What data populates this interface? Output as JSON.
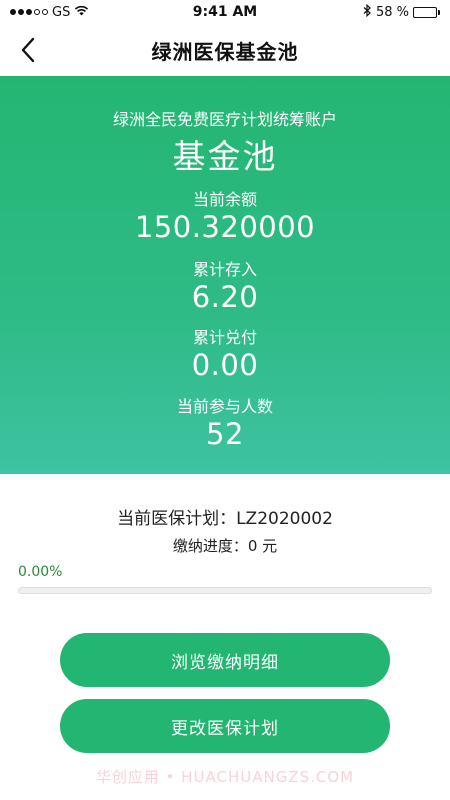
{
  "status_bar": {
    "carrier": "GS",
    "time": "9:41 AM",
    "battery_percent_label": "58 %",
    "battery_level": 0.58
  },
  "nav": {
    "title": "绿洲医保基金池"
  },
  "hero": {
    "subtitle": "绿洲全民免费医疗计划统筹账户",
    "title": "基金池",
    "stats": [
      {
        "label": "当前余额",
        "value": "150.320000"
      },
      {
        "label": "累计存入",
        "value": "6.20"
      },
      {
        "label": "累计兑付",
        "value": "0.00"
      },
      {
        "label": "当前参与人数",
        "value": "52"
      }
    ]
  },
  "plan": {
    "current_plan": "当前医保计划：LZ2020002",
    "payment_progress": "缴纳进度：0 元",
    "percent_label": "0.00%",
    "progress_fraction": 0.0
  },
  "actions": {
    "view_details": "浏览缴纳明细",
    "change_plan": "更改医保计划"
  },
  "watermark": "华创应用 • HUACHUANGZS.COM",
  "colors": {
    "primary_green": "#23b672",
    "percent_text": "#2e8b3a"
  }
}
